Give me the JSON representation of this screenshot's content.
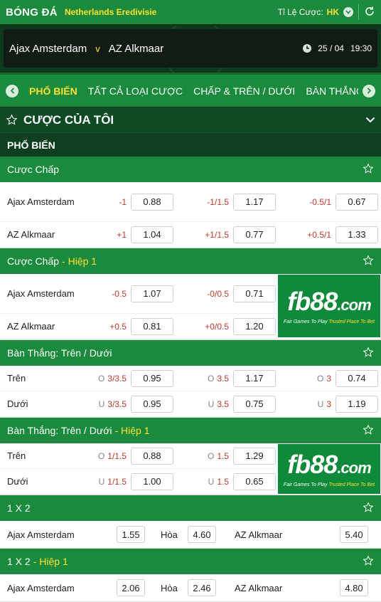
{
  "header": {
    "sport": "BÓNG ĐÁ",
    "league": "Netherlands Eredivisie",
    "odds_label": "Tỉ Lệ Cược:",
    "odds_format": "HK"
  },
  "match": {
    "home": "Ajax Amsterdam",
    "vs": "v",
    "away": "AZ Alkmaar",
    "date": "25 / 04",
    "time": "19:30"
  },
  "tabs": [
    "PHỔ BIẾN",
    "TẤT CẢ LOẠI CƯỢC",
    "CHẤP & TRÊN / DƯỚI",
    "BÀN THẮNG"
  ],
  "my_bets": "CƯỢC CỦA TÔI",
  "popular": "PHỔ BIẾN",
  "ad": {
    "brand": "fb88",
    "domain": ".com",
    "tagline_a": "Fair Games To Play",
    "tagline_b": "Trusted Place To Bet"
  },
  "markets": {
    "handicap": {
      "title": "Cược Chấp",
      "highlight": "",
      "rows": [
        {
          "team": "Ajax Amsterdam",
          "cells": [
            {
              "label": "-1",
              "odd": "0.88"
            },
            {
              "label": "-1/1.5",
              "odd": "1.17"
            },
            {
              "label": "-0.5/1",
              "odd": "0.67"
            }
          ]
        },
        {
          "team": "AZ Alkmaar",
          "cells": [
            {
              "label": "+1",
              "odd": "1.04"
            },
            {
              "label": "+1/1.5",
              "odd": "0.77"
            },
            {
              "label": "+0.5/1",
              "odd": "1.33"
            }
          ]
        }
      ]
    },
    "handicap_h1": {
      "title": "Cược Chấp",
      "highlight": "- Hiệp 1",
      "rows": [
        {
          "team": "Ajax Amsterdam",
          "cells": [
            {
              "label": "-0.5",
              "odd": "1.07"
            },
            {
              "label": "-0/0.5",
              "odd": "0.71"
            }
          ]
        },
        {
          "team": "AZ Alkmaar",
          "cells": [
            {
              "label": "+0.5",
              "odd": "0.81"
            },
            {
              "label": "+0/0.5",
              "odd": "1.20"
            }
          ]
        }
      ]
    },
    "ou": {
      "title": "Bàn Thắng: Trên / Dưới",
      "highlight": "",
      "rows": [
        {
          "team": "Trên",
          "cells": [
            {
              "pre": "O",
              "label": "3/3.5",
              "odd": "0.95"
            },
            {
              "pre": "O",
              "label": "3.5",
              "odd": "1.17"
            },
            {
              "pre": "O",
              "label": "3",
              "odd": "0.74"
            }
          ]
        },
        {
          "team": "Dưới",
          "cells": [
            {
              "pre": "U",
              "label": "3/3.5",
              "odd": "0.95"
            },
            {
              "pre": "U",
              "label": "3.5",
              "odd": "0.75"
            },
            {
              "pre": "U",
              "label": "3",
              "odd": "1.19"
            }
          ]
        }
      ]
    },
    "ou_h1": {
      "title": "Bàn Thắng: Trên / Dưới",
      "highlight": "- Hiệp 1",
      "rows": [
        {
          "team": "Trên",
          "cells": [
            {
              "pre": "O",
              "label": "1/1.5",
              "odd": "0.88"
            },
            {
              "pre": "O",
              "label": "1.5",
              "odd": "1.29"
            }
          ]
        },
        {
          "team": "Dưới",
          "cells": [
            {
              "pre": "U",
              "label": "1/1.5",
              "odd": "1.00"
            },
            {
              "pre": "U",
              "label": "1.5",
              "odd": "0.65"
            }
          ]
        }
      ]
    },
    "x12": {
      "title": "1 X 2",
      "highlight": "",
      "home": "Ajax Amsterdam",
      "home_odd": "1.55",
      "draw": "Hòa",
      "draw_odd": "4.60",
      "away": "AZ Alkmaar",
      "away_odd": "5.40"
    },
    "x12_h1": {
      "title": "1 X 2",
      "highlight": "- Hiệp 1",
      "home": "Ajax Amsterdam",
      "home_odd": "2.06",
      "draw": "Hòa",
      "draw_odd": "2.46",
      "away": "AZ Alkmaar",
      "away_odd": "4.80"
    }
  }
}
